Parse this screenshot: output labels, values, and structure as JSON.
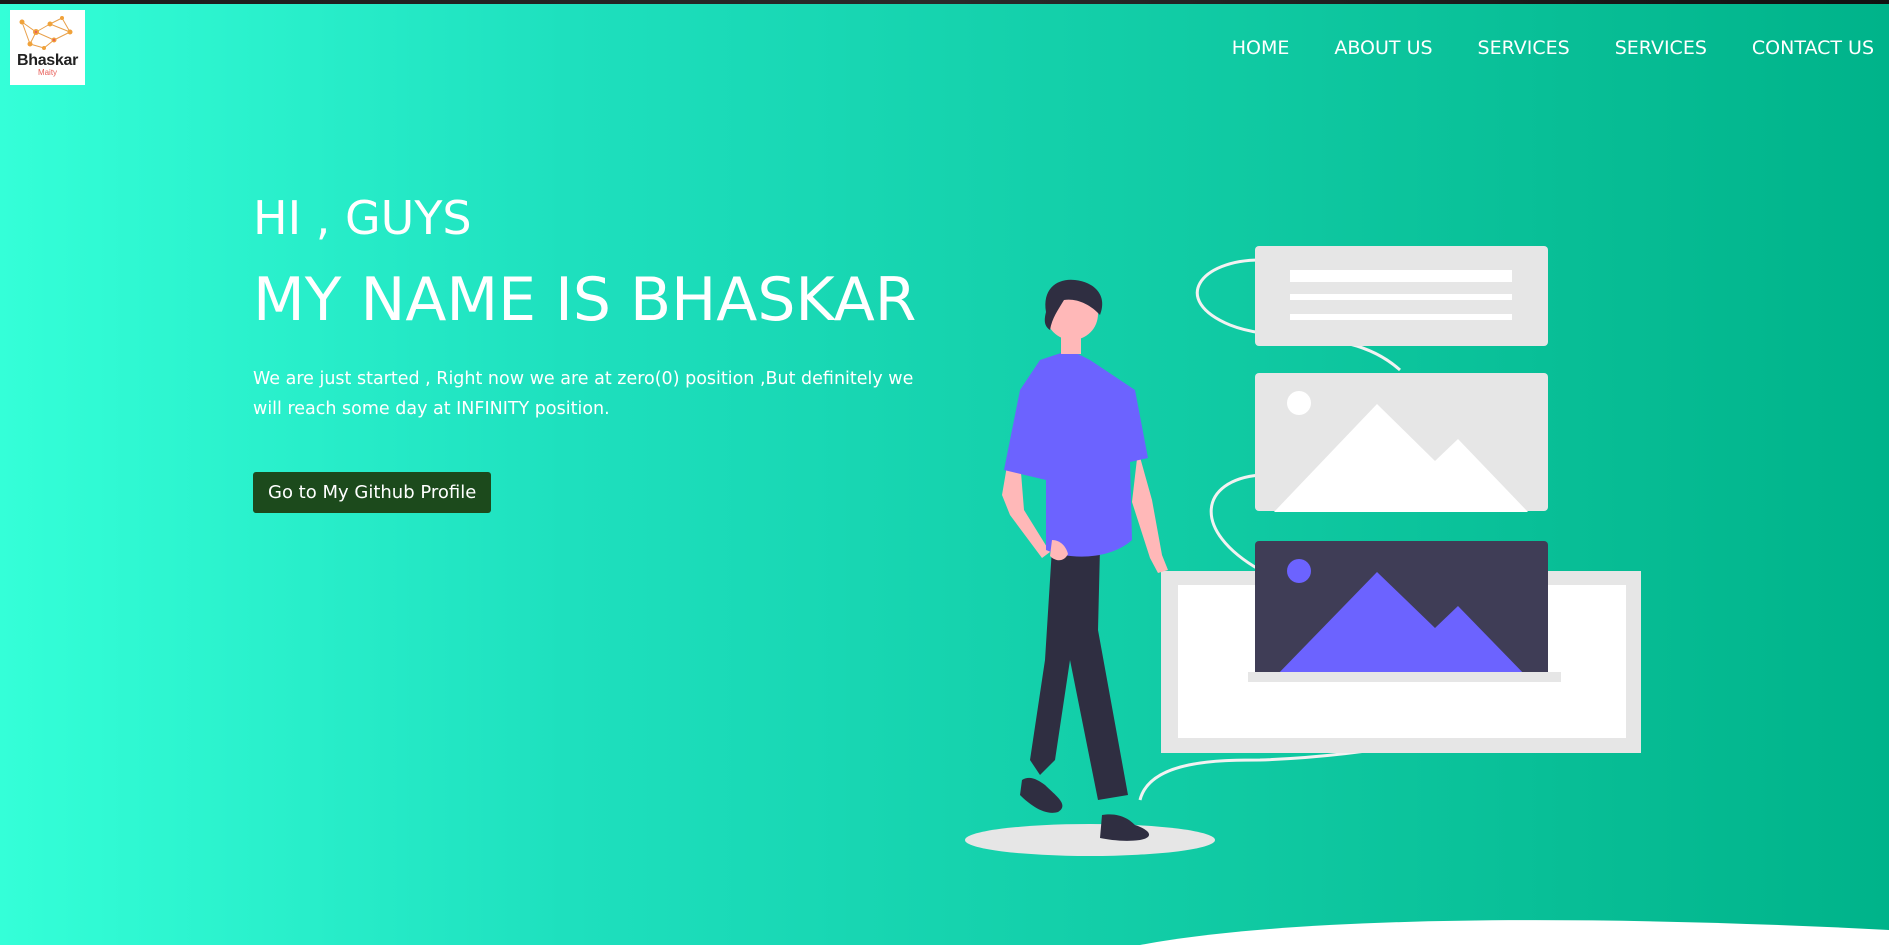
{
  "logo": {
    "title": "Bhaskar",
    "subtitle": "Maity",
    "icon": "network-nodes-icon"
  },
  "nav": {
    "items": [
      {
        "label": "HOME"
      },
      {
        "label": "ABOUT US"
      },
      {
        "label": "SERVICES"
      },
      {
        "label": "SERVICES"
      },
      {
        "label": "CONTACT US"
      }
    ]
  },
  "hero": {
    "greeting": "HI , GUYS",
    "name_line": "MY NAME IS BHASKAR",
    "tagline": "We are just started , Right now we are at zero(0) position ,But definitely we will reach some day at INFINITY position.",
    "button_label": "Go to My Github Profile"
  },
  "illustration": {
    "icon": "person-with-image-cards-illustration"
  },
  "colors": {
    "gradient_start": "#34ffd8",
    "gradient_end": "#00b38a",
    "button_bg": "#1c4a1c",
    "accent_purple": "#6c63ff",
    "card_dark": "#3f3d56"
  }
}
